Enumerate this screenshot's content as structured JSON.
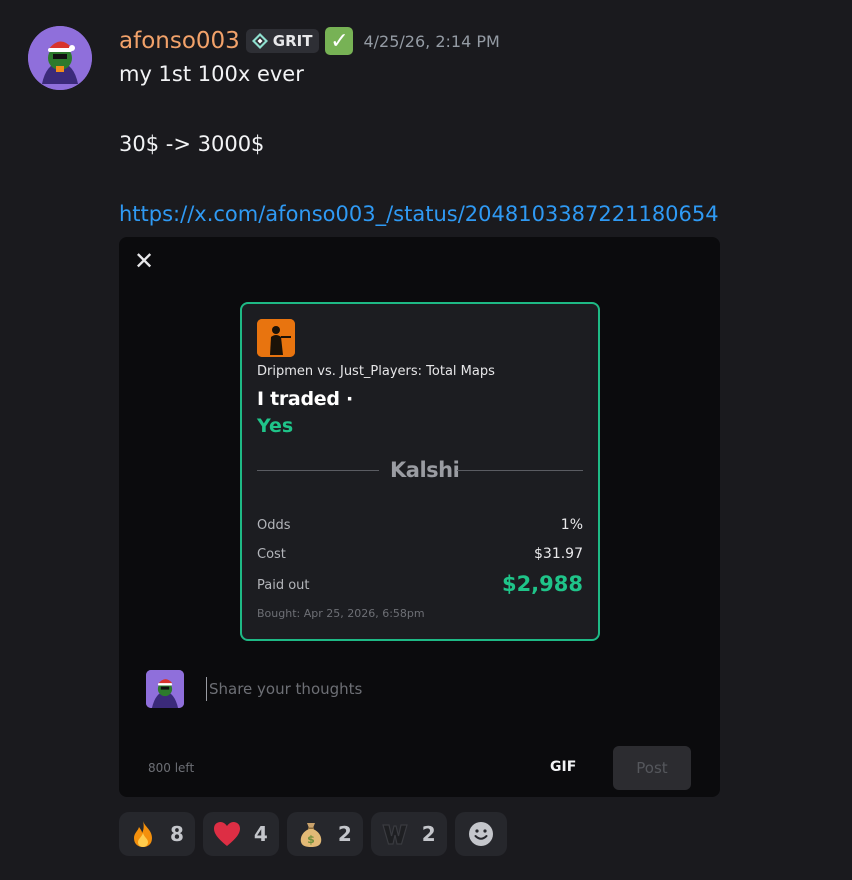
{
  "message": {
    "username": "afonso003",
    "guild_tag": "GRIT",
    "timestamp": "4/25/26, 2:14 PM",
    "lines": [
      "my 1st 100x ever",
      "30$ -> 3000$"
    ],
    "link": "https://x.com/afonso003_/status/2048103387221180654"
  },
  "embed": {
    "close_icon": "close-icon",
    "card": {
      "market": "Dripmen vs. Just_Players: Total Maps",
      "traded_label": "I traded ·",
      "side": "Yes",
      "brand": "Kalshi",
      "odds_label": "Odds",
      "odds_value": "1%",
      "cost_label": "Cost",
      "cost_value": "$31.97",
      "paid_label": "Paid out",
      "paid_value": "$2,988",
      "bought": "Bought: Apr 25, 2026, 6:58pm",
      "accent_color": "#1eb985"
    },
    "composer": {
      "placeholder": "Share your thoughts",
      "chars_left": "800 left",
      "gif_label": "GIF",
      "post_label": "Post"
    }
  },
  "reactions": [
    {
      "icon": "fire-icon",
      "count": "8"
    },
    {
      "icon": "heart-icon",
      "count": "4"
    },
    {
      "icon": "money-bag-icon",
      "count": "2"
    },
    {
      "icon": "w-letter-icon",
      "count": "2"
    }
  ],
  "add_reaction_icon": "smiley-icon",
  "colors": {
    "username": "#f2a26a",
    "link": "#2f9af4",
    "success": "#1fc489"
  }
}
